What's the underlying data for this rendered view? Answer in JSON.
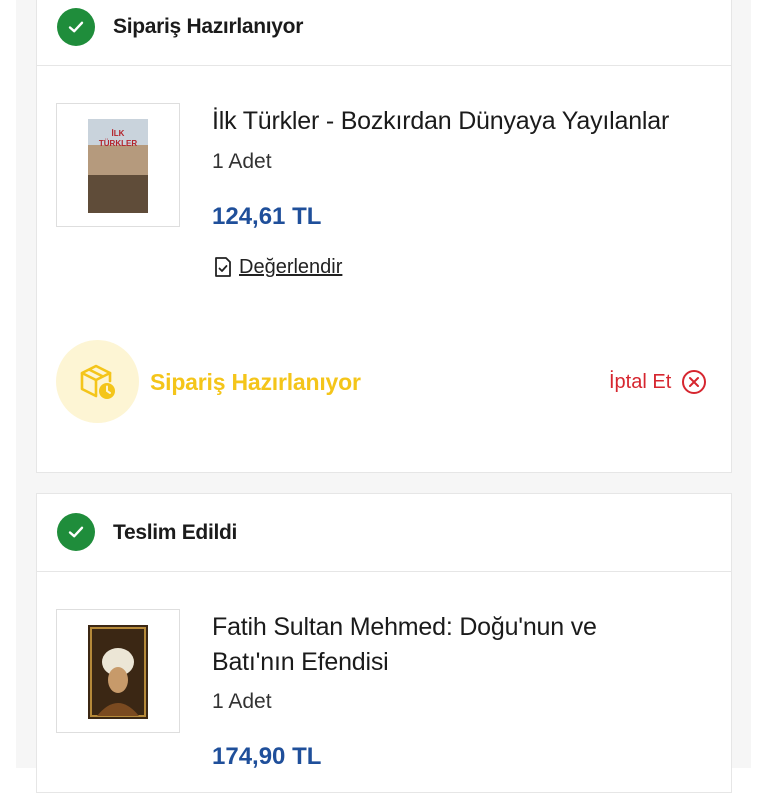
{
  "orders": [
    {
      "status": "Sipariş Hazırlanıyor",
      "product": {
        "title": "İlk Türkler - Bozkırdan Dünyaya Yayılanlar",
        "quantity": "1 Adet",
        "price": "124,61 TL",
        "cover_text": "İLK TÜRKLER"
      },
      "review_label": "Değerlendir",
      "progress_status": "Sipariş Hazırlanıyor",
      "cancel_label": "İptal Et"
    },
    {
      "status": "Teslim Edildi",
      "product": {
        "title_line1": "Fatih Sultan Mehmed: Doğu'nun ve",
        "title_line2": "Batı'nın Efendisi",
        "quantity": "1 Adet",
        "price": "174,90 TL"
      }
    }
  ],
  "colors": {
    "success": "#1f8d3b",
    "price": "#1f4f9a",
    "preparing": "#f4c51a",
    "cancel": "#d6262f"
  }
}
